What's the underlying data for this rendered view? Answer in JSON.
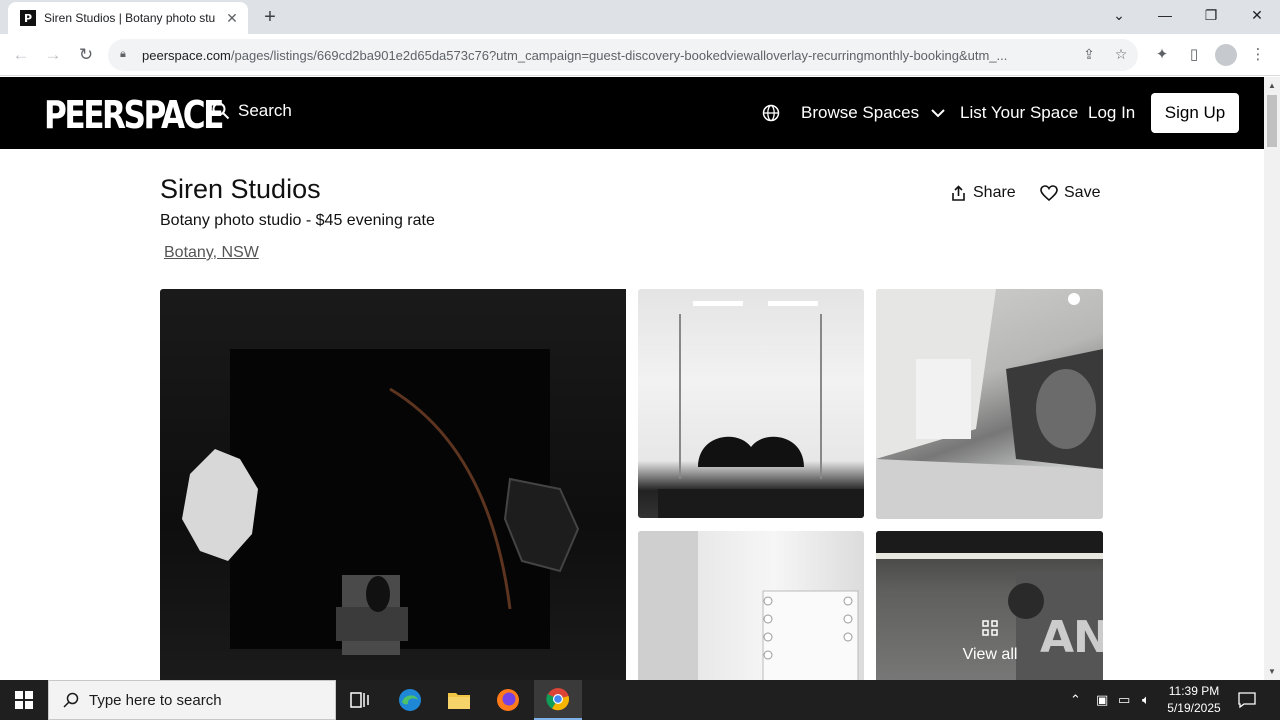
{
  "browser": {
    "tab_title": "Siren Studios | Botany photo stu",
    "favicon_letter": "P",
    "url_host": "peerspace.com",
    "url_path": "/pages/listings/669cd2ba901e2d65da573c76?utm_campaign=guest-discovery-bookedviewalloverlay-recurringmonthly-booking&utm_..."
  },
  "site": {
    "logo": "PEERSPACE",
    "search_label": "Search",
    "nav_browse": "Browse Spaces",
    "nav_list": "List Your Space",
    "nav_login": "Log In",
    "nav_signup": "Sign Up"
  },
  "listing": {
    "title": "Siren Studios",
    "subtitle": "Botany photo studio - $45 evening rate",
    "location": "Botany, NSW",
    "share_label": "Share",
    "save_label": "Save",
    "view_all_label": "View all"
  },
  "watermark": "ANY RUN",
  "taskbar": {
    "search_placeholder": "Type here to search",
    "time": "11:39 PM",
    "date": "5/19/2025"
  }
}
